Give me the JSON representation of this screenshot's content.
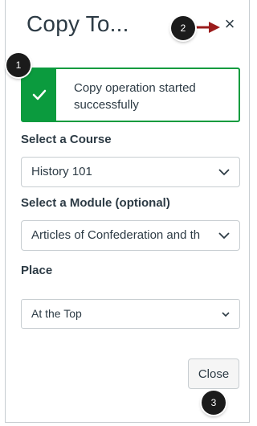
{
  "dialog": {
    "title": "Copy To...",
    "close_glyph": "×"
  },
  "alert": {
    "message": "Copy operation started successfully",
    "status_color": "#0b9b3e",
    "icon": "checkmark-icon"
  },
  "course": {
    "label": "Select a Course",
    "selected": "History 101"
  },
  "module": {
    "label": "Select a Module (optional)",
    "selected": "Articles of Confederation and th"
  },
  "place": {
    "label": "Place",
    "selected": "At the Top"
  },
  "footer": {
    "close_label": "Close"
  },
  "annotations": {
    "markers": [
      "1",
      "2",
      "3"
    ],
    "arrow_color": "#9b1c1c",
    "marker_color": "#1b1b1b"
  }
}
